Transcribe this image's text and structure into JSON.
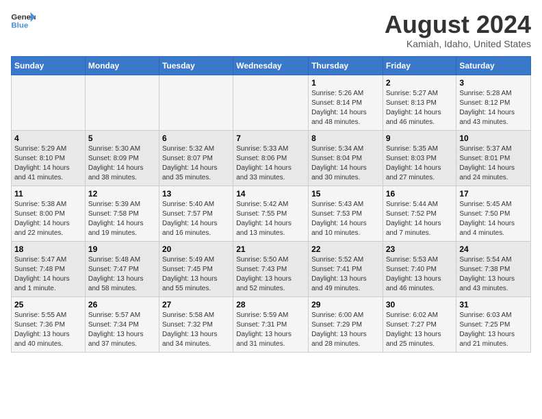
{
  "logo": {
    "line1": "General",
    "line2": "Blue"
  },
  "title": "August 2024",
  "subtitle": "Kamiah, Idaho, United States",
  "days_of_week": [
    "Sunday",
    "Monday",
    "Tuesday",
    "Wednesday",
    "Thursday",
    "Friday",
    "Saturday"
  ],
  "weeks": [
    [
      {
        "day": "",
        "info": ""
      },
      {
        "day": "",
        "info": ""
      },
      {
        "day": "",
        "info": ""
      },
      {
        "day": "",
        "info": ""
      },
      {
        "day": "1",
        "info": "Sunrise: 5:26 AM\nSunset: 8:14 PM\nDaylight: 14 hours\nand 48 minutes."
      },
      {
        "day": "2",
        "info": "Sunrise: 5:27 AM\nSunset: 8:13 PM\nDaylight: 14 hours\nand 46 minutes."
      },
      {
        "day": "3",
        "info": "Sunrise: 5:28 AM\nSunset: 8:12 PM\nDaylight: 14 hours\nand 43 minutes."
      }
    ],
    [
      {
        "day": "4",
        "info": "Sunrise: 5:29 AM\nSunset: 8:10 PM\nDaylight: 14 hours\nand 41 minutes."
      },
      {
        "day": "5",
        "info": "Sunrise: 5:30 AM\nSunset: 8:09 PM\nDaylight: 14 hours\nand 38 minutes."
      },
      {
        "day": "6",
        "info": "Sunrise: 5:32 AM\nSunset: 8:07 PM\nDaylight: 14 hours\nand 35 minutes."
      },
      {
        "day": "7",
        "info": "Sunrise: 5:33 AM\nSunset: 8:06 PM\nDaylight: 14 hours\nand 33 minutes."
      },
      {
        "day": "8",
        "info": "Sunrise: 5:34 AM\nSunset: 8:04 PM\nDaylight: 14 hours\nand 30 minutes."
      },
      {
        "day": "9",
        "info": "Sunrise: 5:35 AM\nSunset: 8:03 PM\nDaylight: 14 hours\nand 27 minutes."
      },
      {
        "day": "10",
        "info": "Sunrise: 5:37 AM\nSunset: 8:01 PM\nDaylight: 14 hours\nand 24 minutes."
      }
    ],
    [
      {
        "day": "11",
        "info": "Sunrise: 5:38 AM\nSunset: 8:00 PM\nDaylight: 14 hours\nand 22 minutes."
      },
      {
        "day": "12",
        "info": "Sunrise: 5:39 AM\nSunset: 7:58 PM\nDaylight: 14 hours\nand 19 minutes."
      },
      {
        "day": "13",
        "info": "Sunrise: 5:40 AM\nSunset: 7:57 PM\nDaylight: 14 hours\nand 16 minutes."
      },
      {
        "day": "14",
        "info": "Sunrise: 5:42 AM\nSunset: 7:55 PM\nDaylight: 14 hours\nand 13 minutes."
      },
      {
        "day": "15",
        "info": "Sunrise: 5:43 AM\nSunset: 7:53 PM\nDaylight: 14 hours\nand 10 minutes."
      },
      {
        "day": "16",
        "info": "Sunrise: 5:44 AM\nSunset: 7:52 PM\nDaylight: 14 hours\nand 7 minutes."
      },
      {
        "day": "17",
        "info": "Sunrise: 5:45 AM\nSunset: 7:50 PM\nDaylight: 14 hours\nand 4 minutes."
      }
    ],
    [
      {
        "day": "18",
        "info": "Sunrise: 5:47 AM\nSunset: 7:48 PM\nDaylight: 14 hours\nand 1 minute."
      },
      {
        "day": "19",
        "info": "Sunrise: 5:48 AM\nSunset: 7:47 PM\nDaylight: 13 hours\nand 58 minutes."
      },
      {
        "day": "20",
        "info": "Sunrise: 5:49 AM\nSunset: 7:45 PM\nDaylight: 13 hours\nand 55 minutes."
      },
      {
        "day": "21",
        "info": "Sunrise: 5:50 AM\nSunset: 7:43 PM\nDaylight: 13 hours\nand 52 minutes."
      },
      {
        "day": "22",
        "info": "Sunrise: 5:52 AM\nSunset: 7:41 PM\nDaylight: 13 hours\nand 49 minutes."
      },
      {
        "day": "23",
        "info": "Sunrise: 5:53 AM\nSunset: 7:40 PM\nDaylight: 13 hours\nand 46 minutes."
      },
      {
        "day": "24",
        "info": "Sunrise: 5:54 AM\nSunset: 7:38 PM\nDaylight: 13 hours\nand 43 minutes."
      }
    ],
    [
      {
        "day": "25",
        "info": "Sunrise: 5:55 AM\nSunset: 7:36 PM\nDaylight: 13 hours\nand 40 minutes."
      },
      {
        "day": "26",
        "info": "Sunrise: 5:57 AM\nSunset: 7:34 PM\nDaylight: 13 hours\nand 37 minutes."
      },
      {
        "day": "27",
        "info": "Sunrise: 5:58 AM\nSunset: 7:32 PM\nDaylight: 13 hours\nand 34 minutes."
      },
      {
        "day": "28",
        "info": "Sunrise: 5:59 AM\nSunset: 7:31 PM\nDaylight: 13 hours\nand 31 minutes."
      },
      {
        "day": "29",
        "info": "Sunrise: 6:00 AM\nSunset: 7:29 PM\nDaylight: 13 hours\nand 28 minutes."
      },
      {
        "day": "30",
        "info": "Sunrise: 6:02 AM\nSunset: 7:27 PM\nDaylight: 13 hours\nand 25 minutes."
      },
      {
        "day": "31",
        "info": "Sunrise: 6:03 AM\nSunset: 7:25 PM\nDaylight: 13 hours\nand 21 minutes."
      }
    ]
  ]
}
